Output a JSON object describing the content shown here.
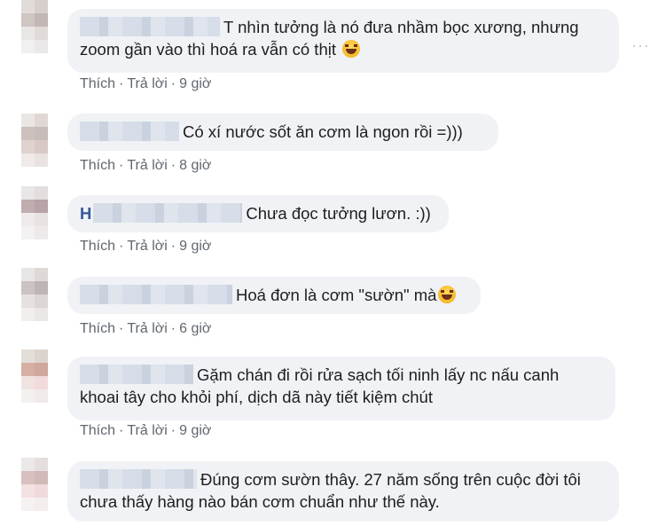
{
  "comments": [
    {
      "name_initial": "",
      "text_lines": [
        "T nhìn tưởng là nó đưa nhầm bọc xương, nhưng",
        "zoom gần vào thì hoá ra vẫn có thịt"
      ],
      "has_emoji": true,
      "emoji_icon": "rolling-laughing-emoji-icon",
      "like_label": "Thích",
      "reply_label": "Trả lời",
      "time": "9 giờ"
    },
    {
      "name_initial": "",
      "text_lines": [
        "Có xí nước sốt ăn cơm là ngon rồi =)))"
      ],
      "has_emoji": false,
      "like_label": "Thích",
      "reply_label": "Trả lời",
      "time": "8 giờ"
    },
    {
      "name_initial": "H",
      "text_lines": [
        "Chưa đọc tưởng lươn. :))"
      ],
      "has_emoji": false,
      "like_label": "Thích",
      "reply_label": "Trả lời",
      "time": "9 giờ"
    },
    {
      "name_initial": "",
      "text_lines": [
        "Hoá đơn là cơm \"sườn\" mà"
      ],
      "has_emoji": true,
      "emoji_icon": "rolling-laughing-emoji-icon",
      "like_label": "Thích",
      "reply_label": "Trả lời",
      "time": "6 giờ"
    },
    {
      "name_initial": "",
      "text_lines": [
        "Gặm chán đi rồi rửa sạch tối ninh lấy nc nấu canh",
        "khoai tây cho khỏi phí, dịch dã này tiết kiệm chút"
      ],
      "has_emoji": false,
      "like_label": "Thích",
      "reply_label": "Trả lời",
      "time": "9 giờ"
    },
    {
      "name_initial": "",
      "text_lines": [
        "Đúng cơm sườn thây. 27 năm sống trên cuộc đời tôi",
        "chưa thấy hàng nào bán cơm chuẩn như thế này."
      ],
      "has_emoji": false
    }
  ],
  "more_options_icon": "more-options-icon",
  "more_options_label": "···",
  "dot_separator": "·"
}
